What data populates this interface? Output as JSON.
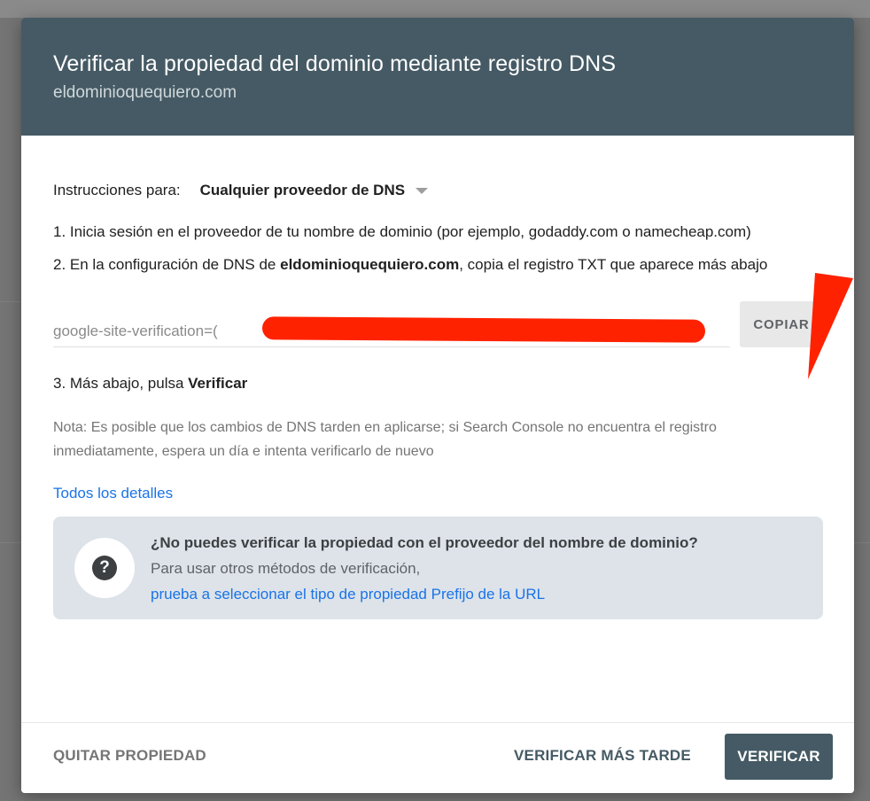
{
  "dialog": {
    "title": "Verificar la propiedad del dominio mediante registro DNS",
    "domain": "eldominioquequiero.com"
  },
  "instructions": {
    "label": "Instrucciones para:",
    "selected_provider": "Cualquier proveedor de DNS"
  },
  "steps": {
    "step1": "1. Inicia sesión en el proveedor de tu nombre de dominio (por ejemplo, godaddy.com o namecheap.com)",
    "step2_prefix": "2. En la configuración de DNS de ",
    "step2_domain": "eldominioquequiero.com",
    "step2_suffix": ", copia el registro TXT que aparece más abajo",
    "step3_prefix": "3. Más abajo, pulsa ",
    "step3_bold": "Verificar"
  },
  "txt_record": {
    "value": "google-site-verification=(",
    "copy_label": "COPIAR"
  },
  "note": "Nota: Es posible que los cambios de DNS tarden en aplicarse; si Search Console no encuentra el registro inmediatamente, espera un día e intenta verificarlo de nuevo",
  "details_link": "Todos los detalles",
  "help": {
    "title": "¿No puedes verificar la propiedad con el proveedor del nombre de dominio?",
    "line": "Para usar otros métodos de verificación,",
    "link": "prueba a seleccionar el tipo de propiedad Prefijo de la URL"
  },
  "footer": {
    "remove_label": "QUITAR PROPIEDAD",
    "later_label": "VERIFICAR MÁS TARDE",
    "verify_label": "VERIFICAR"
  },
  "colors": {
    "header": "#455a64",
    "link": "#1a73e8",
    "annotation": "#ff2200"
  }
}
